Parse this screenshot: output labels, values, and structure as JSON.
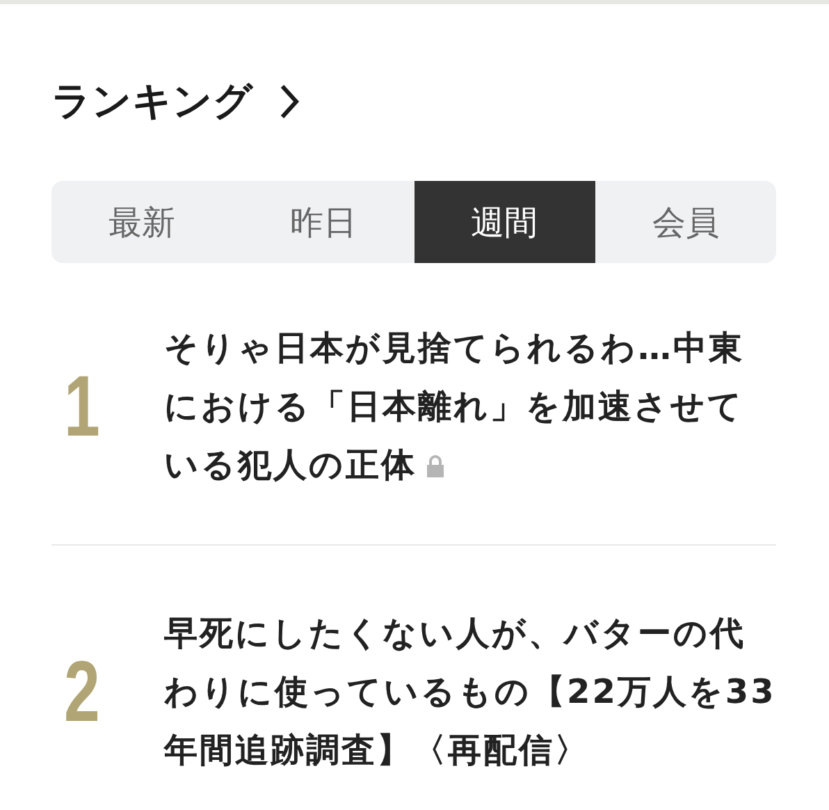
{
  "section": {
    "title": "ランキング"
  },
  "tabs": [
    {
      "label": "最新",
      "selected": false
    },
    {
      "label": "昨日",
      "selected": false
    },
    {
      "label": "週間",
      "selected": true
    },
    {
      "label": "会員",
      "selected": false
    }
  ],
  "articles": [
    {
      "rank": "1",
      "title": "そりゃ日本が見捨てられるわ…中東における「日本離れ」を加速させている犯人の正体",
      "locked": true
    },
    {
      "rank": "2",
      "title": "早死にしたくない人が、バターの代わりに使っているもの【22万人を33年間追跡調査】〈再配信〉",
      "locked": false
    }
  ]
}
